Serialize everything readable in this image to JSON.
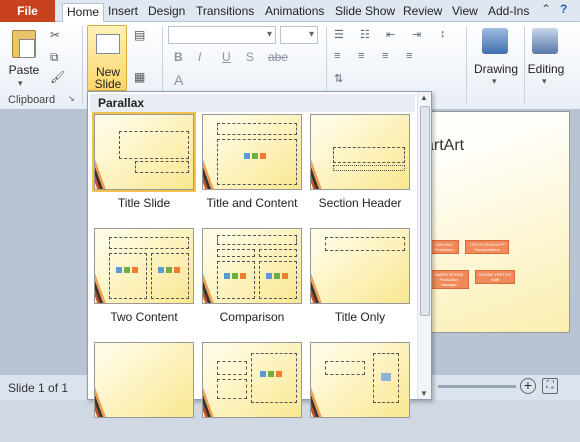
{
  "tabs": {
    "file": "File",
    "items": [
      "Home",
      "Insert",
      "Design",
      "Transitions",
      "Animations",
      "Slide Show",
      "Review",
      "View",
      "Add-Ins"
    ]
  },
  "ribbon": {
    "paste_label": "Paste",
    "clipboard_label": "Clipboard",
    "new_slide_line1": "New",
    "new_slide_line2": "Slide",
    "drawing_label": "Drawing",
    "editing_label": "Editing",
    "format_buttons": [
      "B",
      "I",
      "U",
      "S",
      "abe"
    ]
  },
  "gallery": {
    "title": "Parallax",
    "layouts": [
      "Title Slide",
      "Title and Content",
      "Section Header",
      "Two Content",
      "Comparison",
      "Title Only"
    ]
  },
  "slide": {
    "title_fragment": "artArt",
    "org_boxes": [
      "ANYONG\nProduction",
      "TRITOYONGEA\nPP Transportation",
      "HARDY BYRNE\nProduction\nManager",
      "DONNE YERTVIS\nStaff"
    ]
  },
  "status": {
    "slide_counter": "Slide 1 of 1"
  },
  "colors": {
    "file_tab": "#c8431d",
    "accent_yellow": "#f9e790",
    "stripe_orange": "#c0532a"
  }
}
